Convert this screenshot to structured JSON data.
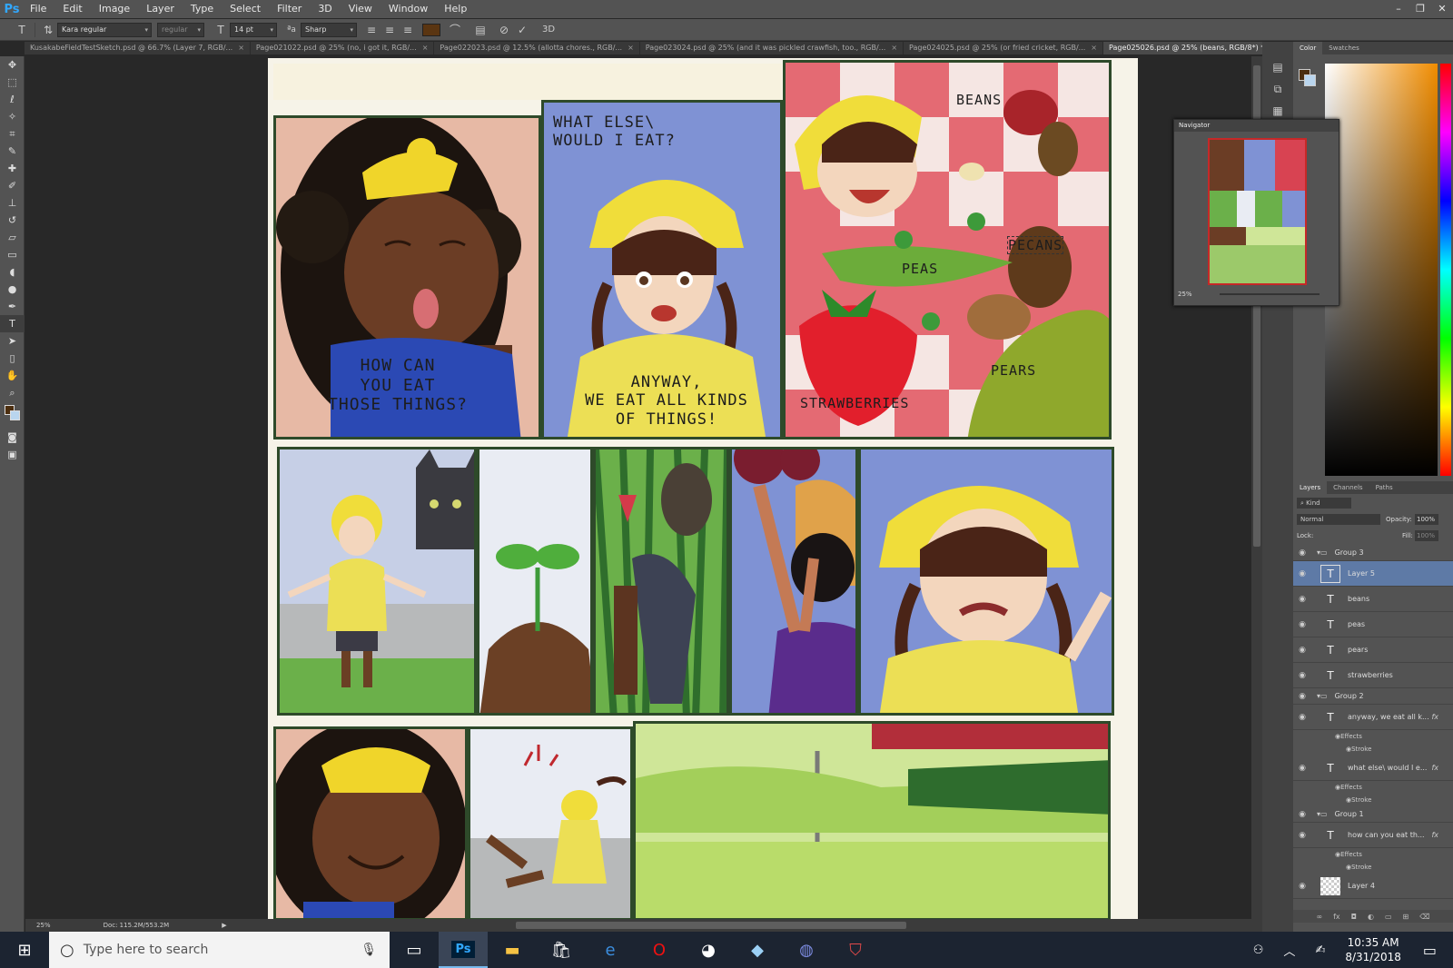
{
  "app": {
    "logo": "Ps"
  },
  "menu": [
    "File",
    "Edit",
    "Image",
    "Layer",
    "Type",
    "Select",
    "Filter",
    "3D",
    "View",
    "Window",
    "Help"
  ],
  "window_controls": {
    "minimize": "–",
    "restore": "❐",
    "close": "✕"
  },
  "options": {
    "font_family": "Kara regular",
    "font_style": "regular",
    "font_size": "14 pt",
    "antialias": "Sharp",
    "text_color": "#5a3511",
    "three_d": "3D"
  },
  "tabs": [
    {
      "label": "KusakabeFieldTestSketch.psd @ 66.7% (Layer 7, RGB/...",
      "active": false
    },
    {
      "label": "Page021022.psd @ 25% (no, i got it, RGB/...",
      "active": false
    },
    {
      "label": "Page022023.psd @ 12.5% (allotta chores., RGB/...",
      "active": false
    },
    {
      "label": "Page023024.psd @ 25% (and  it was pickled  crawfish,  too., RGB/...",
      "active": false
    },
    {
      "label": "Page024025.psd @ 25% (or fried  cricket, RGB/...",
      "active": false
    },
    {
      "label": "Page025026.psd @ 25% (beans, RGB/8*) *",
      "active": true
    }
  ],
  "comic": {
    "bubble_what_else": "WHAT ELSE\\\nWOULD I EAT?",
    "how_can": "HOW CAN\nYOU EAT\nTHOSE THINGS?",
    "anyway": "ANYWAY,\nWE EAT ALL KINDS\nOF THINGS!",
    "beans": "BEANS",
    "pecans": "PECANS",
    "peas": "PEAS",
    "pears": "PEARS",
    "strawberries": "STRAWBERRIES"
  },
  "status": {
    "zoom": "25%",
    "doc": "Doc: 115.2M/553.2M"
  },
  "color_panel": {
    "tabs": [
      "Color",
      "Swatches"
    ],
    "fg": "#4c2e0f",
    "bg": "#b9d5ee"
  },
  "navigator": {
    "title": "Navigator",
    "zoom": "25%"
  },
  "layers_panel": {
    "tabs": [
      "Layers",
      "Channels",
      "Paths"
    ],
    "filter": "Kind",
    "blend": "Normal",
    "opacity_label": "Opacity:",
    "opacity": "100%",
    "lock_label": "Lock:",
    "fill_label": "Fill:",
    "fill": "100%",
    "rows": [
      {
        "type": "group",
        "name": "Group 3"
      },
      {
        "type": "text",
        "name": "Layer 5",
        "selected": true
      },
      {
        "type": "text",
        "name": "beans"
      },
      {
        "type": "text",
        "name": "peas"
      },
      {
        "type": "text",
        "name": "pears"
      },
      {
        "type": "text",
        "name": "strawberries"
      },
      {
        "type": "group",
        "name": "Group 2"
      },
      {
        "type": "text",
        "name": "anyway, we eat all k...",
        "fx": "fx"
      },
      {
        "type": "text",
        "name": "what else\\ would I e...",
        "fx": "fx"
      },
      {
        "type": "group",
        "name": "Group 1"
      },
      {
        "type": "text",
        "name": "how can  you eat th...",
        "fx": "fx"
      },
      {
        "type": "pixel",
        "name": "Layer 4"
      }
    ],
    "effects_label": "Effects",
    "stroke_label": "Stroke"
  },
  "taskbar": {
    "search_placeholder": "Type here to search",
    "time": "10:35 AM",
    "date": "8/31/2018"
  }
}
